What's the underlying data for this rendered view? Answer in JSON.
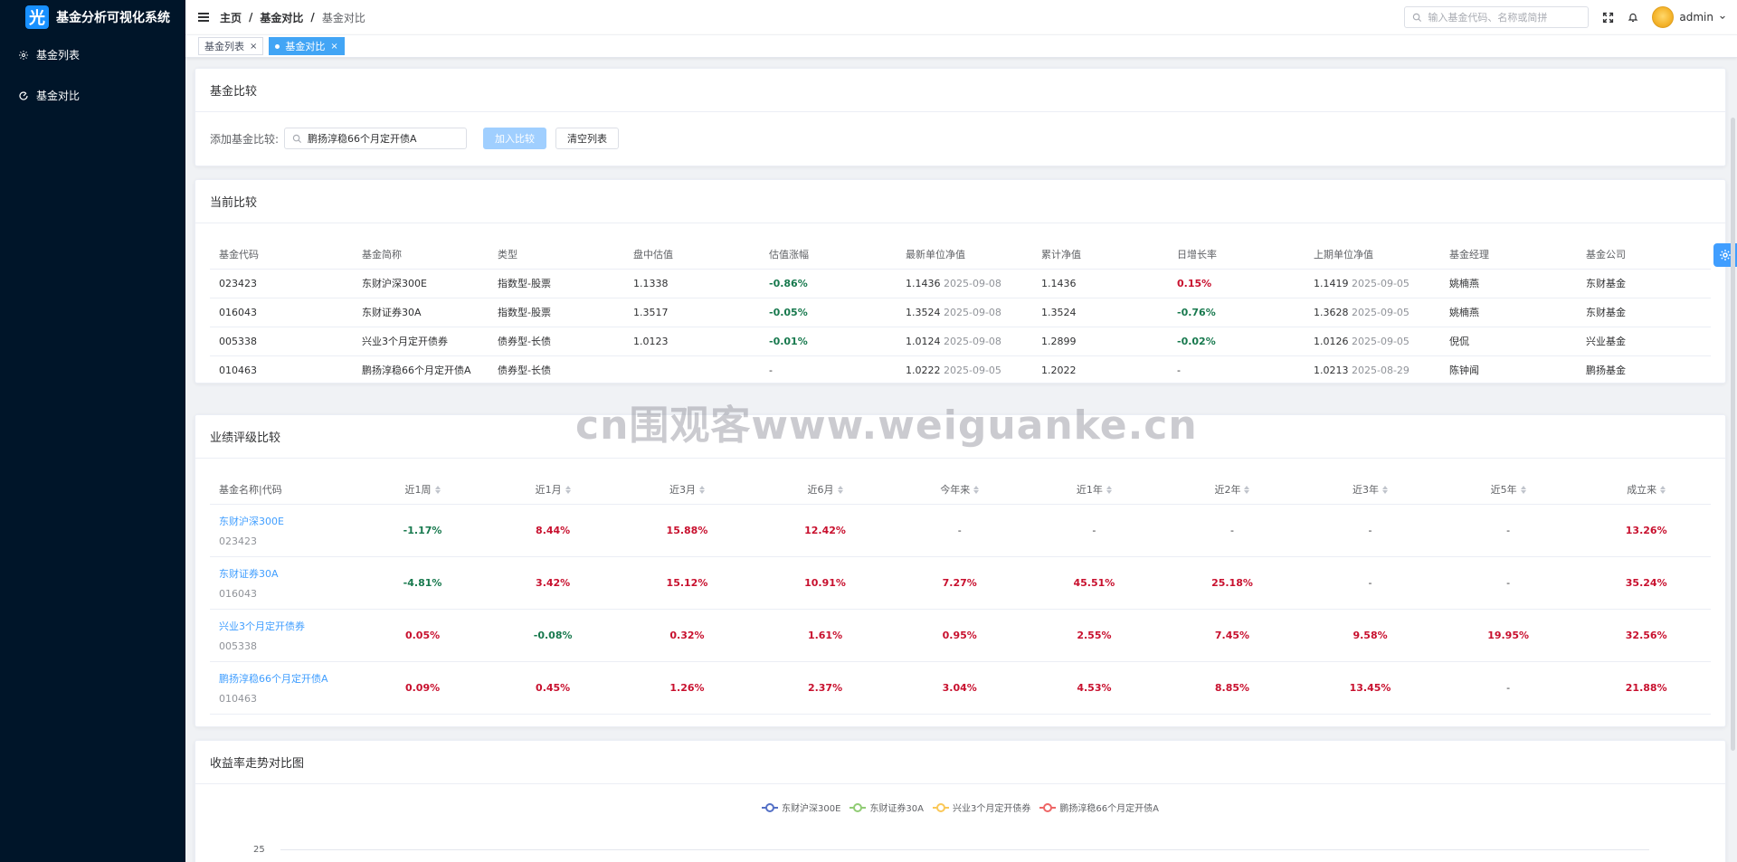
{
  "app": {
    "logo_char": "光",
    "title": "基金分析可视化系统"
  },
  "sidebar": {
    "items": [
      {
        "label": "基金列表",
        "icon": "gear-icon"
      },
      {
        "label": "基金对比",
        "icon": "compare-icon"
      }
    ]
  },
  "header": {
    "breadcrumb": [
      "主页",
      "基金对比",
      "基金对比"
    ],
    "breadcrumb_sep": "/",
    "search_placeholder": "输入基金代码、名称或简拼",
    "user": "admin"
  },
  "tabs": [
    {
      "label": "基金列表",
      "active": false,
      "close": "×"
    },
    {
      "label": "基金对比",
      "active": true,
      "close": "×"
    }
  ],
  "compare_add": {
    "title": "基金比较",
    "label": "添加基金比较:",
    "input_value": "鹏扬淳稳66个月定开债A",
    "add_button": "加入比较",
    "clear_button": "清空列表"
  },
  "current": {
    "title": "当前比较",
    "columns": [
      "基金代码",
      "基金简称",
      "类型",
      "盘中估值",
      "估值涨幅",
      "最新单位净值",
      "累计净值",
      "日增长率",
      "上期单位净值",
      "基金经理",
      "基金公司"
    ],
    "rows": [
      {
        "code": "023423",
        "name": "东财沪深300E",
        "type": "指数型-股票",
        "est": "1.1338",
        "est_chg": "-0.86%",
        "est_dir": "green",
        "nav": "1.1436",
        "nav_date": "2025-09-08",
        "acc": "1.1436",
        "daily": "0.15%",
        "daily_dir": "red",
        "prev": "1.1419",
        "prev_date": "2025-09-05",
        "manager": "姚楠燕",
        "company": "东财基金"
      },
      {
        "code": "016043",
        "name": "东财证券30A",
        "type": "指数型-股票",
        "est": "1.3517",
        "est_chg": "-0.05%",
        "est_dir": "green",
        "nav": "1.3524",
        "nav_date": "2025-09-08",
        "acc": "1.3524",
        "daily": "-0.76%",
        "daily_dir": "green",
        "prev": "1.3628",
        "prev_date": "2025-09-05",
        "manager": "姚楠燕",
        "company": "东财基金"
      },
      {
        "code": "005338",
        "name": "兴业3个月定开债券",
        "type": "债券型-长债",
        "est": "1.0123",
        "est_chg": "-0.01%",
        "est_dir": "green",
        "nav": "1.0124",
        "nav_date": "2025-09-08",
        "acc": "1.2899",
        "daily": "-0.02%",
        "daily_dir": "green",
        "prev": "1.0126",
        "prev_date": "2025-09-05",
        "manager": "倪侃",
        "company": "兴业基金"
      },
      {
        "code": "010463",
        "name": "鹏扬淳稳66个月定开债A",
        "type": "债券型-长债",
        "est": "",
        "est_chg": "-",
        "est_dir": "plain",
        "nav": "1.0222",
        "nav_date": "2025-09-05",
        "acc": "1.2022",
        "daily": "-",
        "daily_dir": "plain",
        "prev": "1.0213",
        "prev_date": "2025-08-29",
        "manager": "陈钟闻",
        "company": "鹏扬基金"
      }
    ]
  },
  "performance": {
    "title": "业绩评级比较",
    "columns": [
      "基金名称|代码",
      "近1周",
      "近1月",
      "近3月",
      "近6月",
      "今年来",
      "近1年",
      "近2年",
      "近3年",
      "近5年",
      "成立来"
    ],
    "rows": [
      {
        "name": "东财沪深300E",
        "code": "023423",
        "values": [
          {
            "v": "-1.17%",
            "c": "green"
          },
          {
            "v": "8.44%",
            "c": "red"
          },
          {
            "v": "15.88%",
            "c": "red"
          },
          {
            "v": "12.42%",
            "c": "red"
          },
          {
            "v": "-",
            "c": "plain"
          },
          {
            "v": "-",
            "c": "plain"
          },
          {
            "v": "-",
            "c": "plain"
          },
          {
            "v": "-",
            "c": "plain"
          },
          {
            "v": "-",
            "c": "plain"
          },
          {
            "v": "13.26%",
            "c": "red"
          }
        ]
      },
      {
        "name": "东财证券30A",
        "code": "016043",
        "values": [
          {
            "v": "-4.81%",
            "c": "green"
          },
          {
            "v": "3.42%",
            "c": "red"
          },
          {
            "v": "15.12%",
            "c": "red"
          },
          {
            "v": "10.91%",
            "c": "red"
          },
          {
            "v": "7.27%",
            "c": "red"
          },
          {
            "v": "45.51%",
            "c": "red"
          },
          {
            "v": "25.18%",
            "c": "red"
          },
          {
            "v": "-",
            "c": "plain"
          },
          {
            "v": "-",
            "c": "plain"
          },
          {
            "v": "35.24%",
            "c": "red"
          }
        ]
      },
      {
        "name": "兴业3个月定开债券",
        "code": "005338",
        "values": [
          {
            "v": "0.05%",
            "c": "red"
          },
          {
            "v": "-0.08%",
            "c": "green"
          },
          {
            "v": "0.32%",
            "c": "red"
          },
          {
            "v": "1.61%",
            "c": "red"
          },
          {
            "v": "0.95%",
            "c": "red"
          },
          {
            "v": "2.55%",
            "c": "red"
          },
          {
            "v": "7.45%",
            "c": "red"
          },
          {
            "v": "9.58%",
            "c": "red"
          },
          {
            "v": "19.95%",
            "c": "red"
          },
          {
            "v": "32.56%",
            "c": "red"
          }
        ]
      },
      {
        "name": "鹏扬淳稳66个月定开债A",
        "code": "010463",
        "values": [
          {
            "v": "0.09%",
            "c": "red"
          },
          {
            "v": "0.45%",
            "c": "red"
          },
          {
            "v": "1.26%",
            "c": "red"
          },
          {
            "v": "2.37%",
            "c": "red"
          },
          {
            "v": "3.04%",
            "c": "red"
          },
          {
            "v": "4.53%",
            "c": "red"
          },
          {
            "v": "8.85%",
            "c": "red"
          },
          {
            "v": "13.45%",
            "c": "red"
          },
          {
            "v": "-",
            "c": "plain"
          },
          {
            "v": "21.88%",
            "c": "red"
          }
        ]
      }
    ]
  },
  "trend": {
    "title": "收益率走势对比图",
    "legend": [
      {
        "name": "东财沪深300E",
        "color": "#5470c6"
      },
      {
        "name": "东财证券30A",
        "color": "#91cc75"
      },
      {
        "name": "兴业3个月定开债券",
        "color": "#fac858"
      },
      {
        "name": "鹏扬淳稳66个月定开债A",
        "color": "#ee6666"
      }
    ],
    "y_tick_top": "25"
  },
  "watermark": "cn围观客www.weiguanke.cn"
}
